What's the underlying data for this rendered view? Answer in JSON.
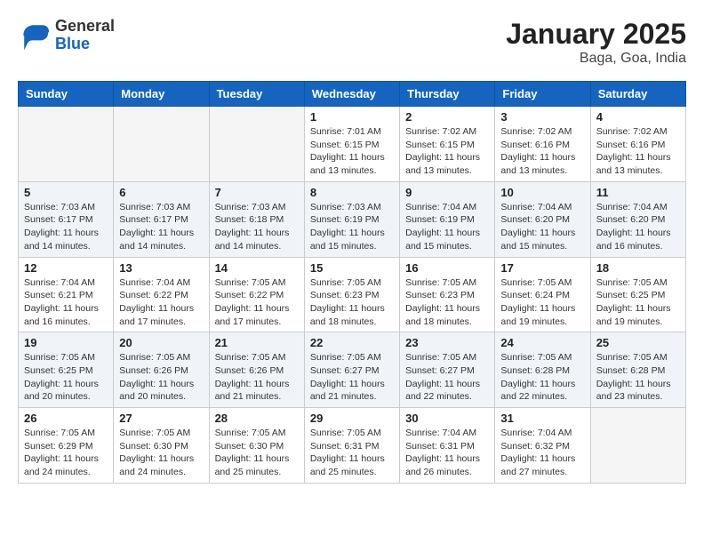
{
  "header": {
    "logo": {
      "general": "General",
      "blue": "Blue"
    },
    "title": "January 2025",
    "subtitle": "Baga, Goa, India"
  },
  "columns": [
    "Sunday",
    "Monday",
    "Tuesday",
    "Wednesday",
    "Thursday",
    "Friday",
    "Saturday"
  ],
  "weeks": [
    [
      {
        "day": "",
        "info": ""
      },
      {
        "day": "",
        "info": ""
      },
      {
        "day": "",
        "info": ""
      },
      {
        "day": "1",
        "info": "Sunrise: 7:01 AM\nSunset: 6:15 PM\nDaylight: 11 hours\nand 13 minutes."
      },
      {
        "day": "2",
        "info": "Sunrise: 7:02 AM\nSunset: 6:15 PM\nDaylight: 11 hours\nand 13 minutes."
      },
      {
        "day": "3",
        "info": "Sunrise: 7:02 AM\nSunset: 6:16 PM\nDaylight: 11 hours\nand 13 minutes."
      },
      {
        "day": "4",
        "info": "Sunrise: 7:02 AM\nSunset: 6:16 PM\nDaylight: 11 hours\nand 13 minutes."
      }
    ],
    [
      {
        "day": "5",
        "info": "Sunrise: 7:03 AM\nSunset: 6:17 PM\nDaylight: 11 hours\nand 14 minutes."
      },
      {
        "day": "6",
        "info": "Sunrise: 7:03 AM\nSunset: 6:17 PM\nDaylight: 11 hours\nand 14 minutes."
      },
      {
        "day": "7",
        "info": "Sunrise: 7:03 AM\nSunset: 6:18 PM\nDaylight: 11 hours\nand 14 minutes."
      },
      {
        "day": "8",
        "info": "Sunrise: 7:03 AM\nSunset: 6:19 PM\nDaylight: 11 hours\nand 15 minutes."
      },
      {
        "day": "9",
        "info": "Sunrise: 7:04 AM\nSunset: 6:19 PM\nDaylight: 11 hours\nand 15 minutes."
      },
      {
        "day": "10",
        "info": "Sunrise: 7:04 AM\nSunset: 6:20 PM\nDaylight: 11 hours\nand 15 minutes."
      },
      {
        "day": "11",
        "info": "Sunrise: 7:04 AM\nSunset: 6:20 PM\nDaylight: 11 hours\nand 16 minutes."
      }
    ],
    [
      {
        "day": "12",
        "info": "Sunrise: 7:04 AM\nSunset: 6:21 PM\nDaylight: 11 hours\nand 16 minutes."
      },
      {
        "day": "13",
        "info": "Sunrise: 7:04 AM\nSunset: 6:22 PM\nDaylight: 11 hours\nand 17 minutes."
      },
      {
        "day": "14",
        "info": "Sunrise: 7:05 AM\nSunset: 6:22 PM\nDaylight: 11 hours\nand 17 minutes."
      },
      {
        "day": "15",
        "info": "Sunrise: 7:05 AM\nSunset: 6:23 PM\nDaylight: 11 hours\nand 18 minutes."
      },
      {
        "day": "16",
        "info": "Sunrise: 7:05 AM\nSunset: 6:23 PM\nDaylight: 11 hours\nand 18 minutes."
      },
      {
        "day": "17",
        "info": "Sunrise: 7:05 AM\nSunset: 6:24 PM\nDaylight: 11 hours\nand 19 minutes."
      },
      {
        "day": "18",
        "info": "Sunrise: 7:05 AM\nSunset: 6:25 PM\nDaylight: 11 hours\nand 19 minutes."
      }
    ],
    [
      {
        "day": "19",
        "info": "Sunrise: 7:05 AM\nSunset: 6:25 PM\nDaylight: 11 hours\nand 20 minutes."
      },
      {
        "day": "20",
        "info": "Sunrise: 7:05 AM\nSunset: 6:26 PM\nDaylight: 11 hours\nand 20 minutes."
      },
      {
        "day": "21",
        "info": "Sunrise: 7:05 AM\nSunset: 6:26 PM\nDaylight: 11 hours\nand 21 minutes."
      },
      {
        "day": "22",
        "info": "Sunrise: 7:05 AM\nSunset: 6:27 PM\nDaylight: 11 hours\nand 21 minutes."
      },
      {
        "day": "23",
        "info": "Sunrise: 7:05 AM\nSunset: 6:27 PM\nDaylight: 11 hours\nand 22 minutes."
      },
      {
        "day": "24",
        "info": "Sunrise: 7:05 AM\nSunset: 6:28 PM\nDaylight: 11 hours\nand 22 minutes."
      },
      {
        "day": "25",
        "info": "Sunrise: 7:05 AM\nSunset: 6:28 PM\nDaylight: 11 hours\nand 23 minutes."
      }
    ],
    [
      {
        "day": "26",
        "info": "Sunrise: 7:05 AM\nSunset: 6:29 PM\nDaylight: 11 hours\nand 24 minutes."
      },
      {
        "day": "27",
        "info": "Sunrise: 7:05 AM\nSunset: 6:30 PM\nDaylight: 11 hours\nand 24 minutes."
      },
      {
        "day": "28",
        "info": "Sunrise: 7:05 AM\nSunset: 6:30 PM\nDaylight: 11 hours\nand 25 minutes."
      },
      {
        "day": "29",
        "info": "Sunrise: 7:05 AM\nSunset: 6:31 PM\nDaylight: 11 hours\nand 25 minutes."
      },
      {
        "day": "30",
        "info": "Sunrise: 7:04 AM\nSunset: 6:31 PM\nDaylight: 11 hours\nand 26 minutes."
      },
      {
        "day": "31",
        "info": "Sunrise: 7:04 AM\nSunset: 6:32 PM\nDaylight: 11 hours\nand 27 minutes."
      },
      {
        "day": "",
        "info": ""
      }
    ]
  ]
}
